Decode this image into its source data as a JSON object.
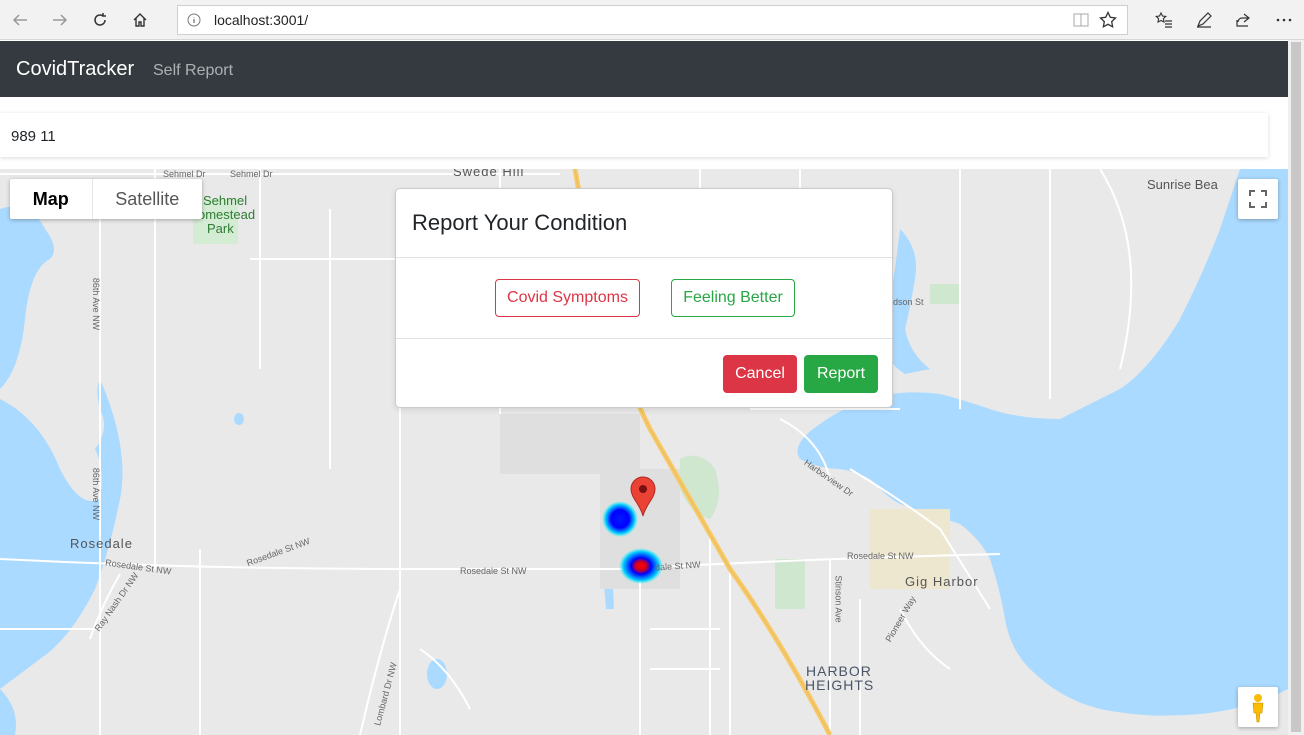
{
  "browser": {
    "url": "localhost:3001/",
    "back_icon": "arrow-left-icon",
    "forward_icon": "arrow-right-icon",
    "refresh_icon": "refresh-icon",
    "home_icon": "home-icon",
    "info_icon": "info-icon",
    "reader_icon": "reading-view-icon",
    "favorite_icon": "star-icon",
    "favorites_list_icon": "favorites-icon",
    "pen_icon": "pen-icon",
    "share_icon": "share-icon",
    "more_icon": "more-icon"
  },
  "navbar": {
    "brand": "CovidTracker",
    "link": "Self Report"
  },
  "info_card": {
    "text": "989 11"
  },
  "map": {
    "type_map": "Map",
    "type_satellite": "Satellite",
    "labels": {
      "sehmel_dr_left": "Sehmel Dr",
      "sehmel_dr_right": "Sehmel Dr",
      "swede_hill": "Swede Hill",
      "sehmel_homestead": "Sehmel",
      "homestead": "omestead",
      "park": "Park",
      "sunrise_beach": "Sunrise Bea",
      "ave_86th_top": "86th Ave NW",
      "ave_86th_bottom": "86th Ave NW",
      "rosedale": "Rosedale",
      "rosedale_st_1": "Rosedale St NW",
      "rosedale_st_2": "Rosedale St NW",
      "rosedale_st_3": "Rosedale St NW",
      "rosedale_st_4": "Rosedale St NW",
      "rosedale_st_5": "dale St NW",
      "ray_nash": "Ray Nash Dr NW",
      "harborview": "Harborview Dr",
      "gig_harbor": "Gig Harbor",
      "stinson": "Stinson Ave",
      "pioneer": "Pioneer Way",
      "harbor": "HARBOR",
      "heights": "HEIGHTS",
      "lombard": "Lombard Dr NW",
      "hudson": "dson St"
    }
  },
  "modal": {
    "title": "Report Your Condition",
    "symptoms_button": "Covid Symptoms",
    "better_button": "Feeling Better",
    "cancel_button": "Cancel",
    "report_button": "Report"
  },
  "colors": {
    "navbar": "#343a40",
    "danger": "#dc3545",
    "success": "#28a745",
    "water": "#aadaff",
    "highway": "#f8c967"
  }
}
